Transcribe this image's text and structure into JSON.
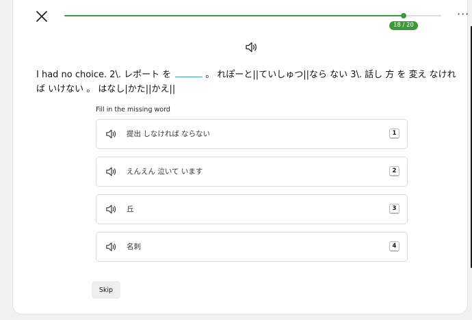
{
  "header": {
    "close_icon": "close-icon",
    "more_icon": "more-options-icon",
    "more_label": "···",
    "progress": {
      "current": 18,
      "total": 20,
      "label": "18 / 20"
    },
    "accent_color": "#3d9a3a"
  },
  "question": {
    "audio_icon": "speaker-icon",
    "sentence_before": "I had no choice. 2\\. レポート を",
    "sentence_after": "。 れぽーと||ていしゅつ||なら ない 3\\. 話し 方 を 変え なければ いけない 。 はなし|かた||かえ||",
    "instruction": "Fill in the missing word"
  },
  "options": [
    {
      "label": "提出 しなければ ならない",
      "key": "1"
    },
    {
      "label": "えんえん 泣いて います",
      "key": "2"
    },
    {
      "label": "丘",
      "key": "3"
    },
    {
      "label": "名刺",
      "key": "4"
    }
  ],
  "footer": {
    "skip_label": "Skip"
  }
}
